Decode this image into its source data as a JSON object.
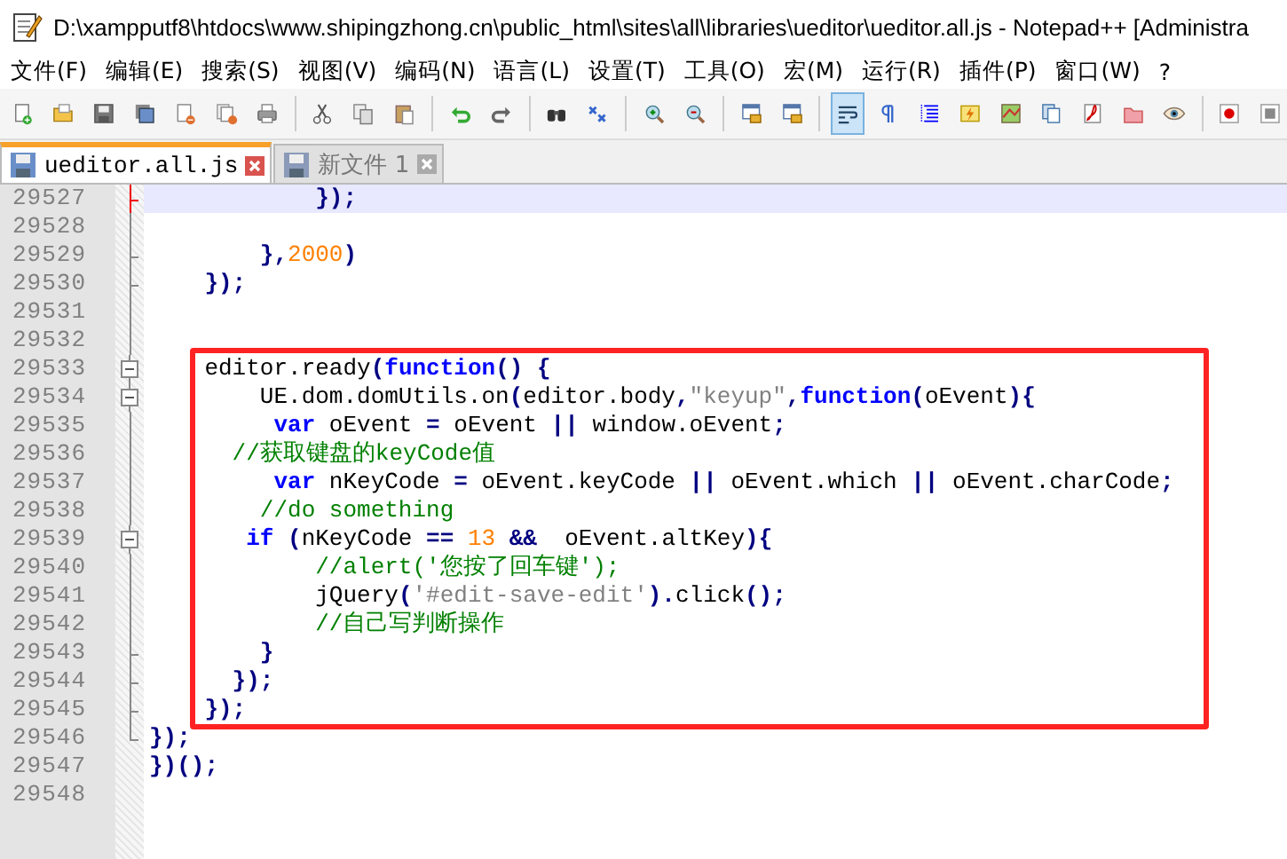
{
  "window": {
    "title": "D:\\xampputf8\\htdocs\\www.shipingzhong.cn\\public_html\\sites\\all\\libraries\\ueditor\\ueditor.all.js - Notepad++ [Administra"
  },
  "menu": [
    "文件(F)",
    "编辑(E)",
    "搜索(S)",
    "视图(V)",
    "编码(N)",
    "语言(L)",
    "设置(T)",
    "工具(O)",
    "宏(M)",
    "运行(R)",
    "插件(P)",
    "窗口(W)",
    "?"
  ],
  "toolbar": [
    {
      "kind": "new",
      "pressed": false
    },
    {
      "kind": "open",
      "pressed": false
    },
    {
      "kind": "save",
      "pressed": false
    },
    {
      "kind": "save-all",
      "pressed": false
    },
    {
      "kind": "close",
      "pressed": false
    },
    {
      "kind": "close-all",
      "pressed": false
    },
    {
      "kind": "print",
      "pressed": false
    },
    {
      "kind": "sep"
    },
    {
      "kind": "cut",
      "pressed": false
    },
    {
      "kind": "copy",
      "pressed": false
    },
    {
      "kind": "paste",
      "pressed": false
    },
    {
      "kind": "sep"
    },
    {
      "kind": "undo",
      "pressed": false
    },
    {
      "kind": "redo",
      "pressed": false
    },
    {
      "kind": "sep"
    },
    {
      "kind": "find",
      "pressed": false
    },
    {
      "kind": "replace",
      "pressed": false
    },
    {
      "kind": "sep"
    },
    {
      "kind": "zoom-in",
      "pressed": false
    },
    {
      "kind": "zoom-out",
      "pressed": false
    },
    {
      "kind": "sep"
    },
    {
      "kind": "sync-v",
      "pressed": false
    },
    {
      "kind": "sync-h",
      "pressed": false
    },
    {
      "kind": "sep"
    },
    {
      "kind": "wrap",
      "pressed": true
    },
    {
      "kind": "pilcrow",
      "pressed": false
    },
    {
      "kind": "guide",
      "pressed": false
    },
    {
      "kind": "lightning",
      "pressed": false
    },
    {
      "kind": "map",
      "pressed": false
    },
    {
      "kind": "docs",
      "pressed": false
    },
    {
      "kind": "pdf",
      "pressed": false
    },
    {
      "kind": "folder",
      "pressed": false
    },
    {
      "kind": "eye",
      "pressed": false
    },
    {
      "kind": "sep"
    },
    {
      "kind": "record",
      "pressed": false
    },
    {
      "kind": "stop",
      "pressed": false
    }
  ],
  "tabs": [
    {
      "label": "ueditor.all.js",
      "selected": true
    },
    {
      "label": "新文件 1",
      "selected": false
    }
  ],
  "code": [
    {
      "kind": "plain",
      "lines": [
        {
          "number": "29527",
          "kind": "tick",
          "current": true,
          "tokens": [
            {
              "kind": "op",
              "text": "            });"
            }
          ]
        },
        {
          "number": "29528",
          "kind": "line",
          "current": false
        },
        {
          "number": "29529",
          "kind": "tick",
          "current": false,
          "tokens": [
            {
              "kind": "op",
              "text": "        },"
            },
            {
              "kind": "num",
              "text": "2000"
            },
            {
              "kind": "op",
              "text": ")"
            }
          ]
        },
        {
          "number": "29530",
          "kind": "tick",
          "current": false,
          "tokens": [
            {
              "kind": "op",
              "text": "    });"
            }
          ]
        },
        {
          "number": "29531",
          "kind": "line",
          "current": false
        },
        {
          "number": "29532",
          "kind": "line",
          "current": false
        }
      ]
    },
    {
      "kind": "boxed",
      "lines": [
        {
          "number": "29533",
          "kind": "box",
          "current": false,
          "tokens": [
            {
              "kind": "id",
              "text": "    editor.ready"
            },
            {
              "kind": "op",
              "text": "("
            },
            {
              "kind": "kw",
              "text": "function"
            },
            {
              "kind": "op",
              "text": "() {"
            }
          ]
        },
        {
          "number": "29534",
          "kind": "box",
          "current": false,
          "tokens": [
            {
              "kind": "id",
              "text": "        UE.dom.domUtils.on"
            },
            {
              "kind": "op",
              "text": "("
            },
            {
              "kind": "id",
              "text": "editor.body"
            },
            {
              "kind": "op",
              "text": ","
            },
            {
              "kind": "str",
              "text": "\"keyup\""
            },
            {
              "kind": "op",
              "text": ","
            },
            {
              "kind": "kw",
              "text": "function"
            },
            {
              "kind": "op",
              "text": "("
            },
            {
              "kind": "id",
              "text": "oEvent"
            },
            {
              "kind": "op",
              "text": "){"
            }
          ]
        },
        {
          "number": "29535",
          "kind": "line",
          "current": false,
          "tokens": [
            {
              "kind": "kw",
              "text": "         var"
            },
            {
              "kind": "id",
              "text": " oEvent "
            },
            {
              "kind": "op",
              "text": "="
            },
            {
              "kind": "id",
              "text": " oEvent "
            },
            {
              "kind": "op",
              "text": "||"
            },
            {
              "kind": "id",
              "text": " window.oEvent"
            },
            {
              "kind": "op",
              "text": ";"
            }
          ]
        },
        {
          "number": "29536",
          "kind": "line",
          "current": false,
          "tokens": [
            {
              "kind": "cmt",
              "text": "      //获取键盘的keyCode值"
            }
          ]
        },
        {
          "number": "29537",
          "kind": "line",
          "current": false,
          "tokens": [
            {
              "kind": "kw",
              "text": "         var"
            },
            {
              "kind": "id",
              "text": " nKeyCode "
            },
            {
              "kind": "op",
              "text": "="
            },
            {
              "kind": "id",
              "text": " oEvent.keyCode "
            },
            {
              "kind": "op",
              "text": "||"
            },
            {
              "kind": "id",
              "text": " oEvent.which "
            },
            {
              "kind": "op",
              "text": "||"
            },
            {
              "kind": "id",
              "text": " oEvent.charCode"
            },
            {
              "kind": "op",
              "text": ";"
            }
          ]
        },
        {
          "number": "29538",
          "kind": "line",
          "current": false,
          "tokens": [
            {
              "kind": "cmt",
              "text": "        //do something"
            }
          ]
        },
        {
          "number": "29539",
          "kind": "box",
          "current": false,
          "tokens": [
            {
              "kind": "kw",
              "text": "       if"
            },
            {
              "kind": "op",
              "text": " ("
            },
            {
              "kind": "id",
              "text": "nKeyCode "
            },
            {
              "kind": "op",
              "text": "=="
            },
            {
              "kind": "num",
              "text": " 13 "
            },
            {
              "kind": "op",
              "text": "&&"
            },
            {
              "kind": "id",
              "text": "  oEvent.altKey"
            },
            {
              "kind": "op",
              "text": "){"
            }
          ]
        },
        {
          "number": "29540",
          "kind": "line",
          "current": false,
          "tokens": [
            {
              "kind": "cmt",
              "text": "            //alert('您按了回车键');"
            }
          ]
        },
        {
          "number": "29541",
          "kind": "line",
          "current": false,
          "tokens": [
            {
              "kind": "id",
              "text": "            jQuery"
            },
            {
              "kind": "op",
              "text": "("
            },
            {
              "kind": "str",
              "text": "'#edit-save-edit'"
            },
            {
              "kind": "op",
              "text": ")."
            },
            {
              "kind": "id",
              "text": "click"
            },
            {
              "kind": "op",
              "text": "();"
            }
          ]
        },
        {
          "number": "29542",
          "kind": "line",
          "current": false,
          "tokens": [
            {
              "kind": "cmt",
              "text": "            //自己写判断操作"
            }
          ]
        },
        {
          "number": "29543",
          "kind": "tick",
          "current": false,
          "tokens": [
            {
              "kind": "op",
              "text": "        }"
            }
          ]
        },
        {
          "number": "29544",
          "kind": "tick",
          "current": false,
          "tokens": [
            {
              "kind": "op",
              "text": "      });"
            }
          ]
        },
        {
          "number": "29545",
          "kind": "tick",
          "current": false,
          "tokens": [
            {
              "kind": "op",
              "text": "    });"
            }
          ]
        }
      ]
    },
    {
      "kind": "plain",
      "lines": [
        {
          "number": "29546",
          "kind": "end",
          "current": false,
          "tokens": [
            {
              "kind": "op",
              "text": "});"
            }
          ]
        },
        {
          "number": "29547",
          "kind": "plain",
          "current": false,
          "tokens": [
            {
              "kind": "op",
              "text": "})();"
            }
          ]
        },
        {
          "number": "29548",
          "kind": "plain",
          "current": false
        }
      ]
    }
  ]
}
